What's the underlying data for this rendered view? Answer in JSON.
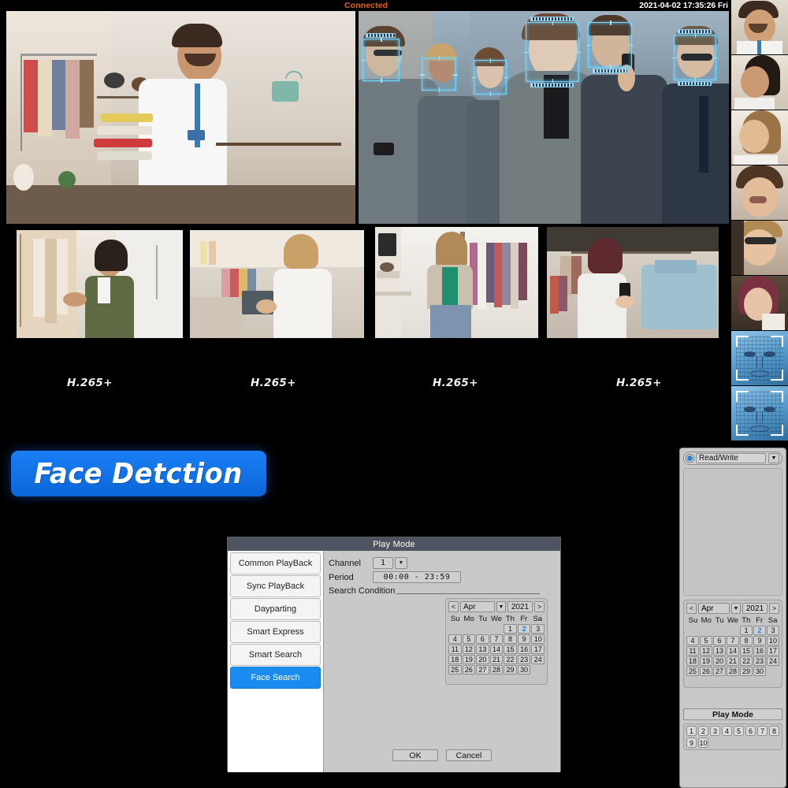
{
  "statusbar": {
    "connected": "Connected",
    "datetime": "2021-04-02 17:35:26 Fri"
  },
  "liveview": {
    "panes": [
      {
        "name": "pane-1",
        "codec": ""
      },
      {
        "name": "pane-2",
        "codec": ""
      },
      {
        "name": "pane-3",
        "codec": "H.265+"
      },
      {
        "name": "pane-4",
        "codec": "H.265+"
      },
      {
        "name": "pane-5",
        "codec": "H.265+"
      },
      {
        "name": "pane-6",
        "codec": "H.265+"
      }
    ],
    "codec_labels": [
      "H.265+",
      "H.265+",
      "H.265+",
      "H.265+"
    ]
  },
  "banner": {
    "text": "Face Detction"
  },
  "dialog": {
    "title": "Play Mode",
    "modes": [
      {
        "label": "Common PlayBack",
        "active": false
      },
      {
        "label": "Sync PlayBack",
        "active": false
      },
      {
        "label": "Dayparting",
        "active": false
      },
      {
        "label": "Smart Express",
        "active": false
      },
      {
        "label": "Smart Search",
        "active": false
      },
      {
        "label": "Face Search",
        "active": true
      }
    ],
    "channel_label": "Channel",
    "channel_value": "1",
    "period_label": "Period",
    "period_value": "00:00  -  23:59",
    "search_condition_label": "Search Condition",
    "calendar": {
      "prev": "<",
      "next": ">",
      "month": "Apr",
      "year": "2021",
      "dow": [
        "Su",
        "Mo",
        "Tu",
        "We",
        "Th",
        "Fr",
        "Sa"
      ],
      "lead_blanks": 4,
      "days": [
        1,
        2,
        3,
        4,
        5,
        6,
        7,
        8,
        9,
        10,
        11,
        12,
        13,
        14,
        15,
        16,
        17,
        18,
        19,
        20,
        21,
        22,
        23,
        24,
        25,
        26,
        27,
        28,
        29,
        30
      ],
      "selected": 2
    },
    "ok_label": "OK",
    "cancel_label": "Cancel"
  },
  "sidepanel": {
    "readwrite_label": "Read/Write",
    "calendar": {
      "prev": "<",
      "next": ">",
      "month": "Apr",
      "year": "2021",
      "dow": [
        "Su",
        "Mo",
        "Tu",
        "We",
        "Th",
        "Fr",
        "Sa"
      ],
      "lead_blanks": 4,
      "days": [
        1,
        2,
        3,
        4,
        5,
        6,
        7,
        8,
        9,
        10,
        11,
        12,
        13,
        14,
        15,
        16,
        17,
        18,
        19,
        20,
        21,
        22,
        23,
        24,
        25,
        26,
        27,
        28,
        29,
        30
      ],
      "selected": 2
    },
    "playmode_label": "Play Mode",
    "channels": [
      1,
      2,
      3,
      4,
      5,
      6,
      7,
      8,
      9,
      10
    ]
  },
  "colors": {
    "accent_blue": "#1a8cf0",
    "banner_blue": "#0a66d8",
    "connected_orange": "#e2661a",
    "face_box_cyan": "#6fd4ff",
    "dialog_gray": "#c9c9c9",
    "titlebar_gray": "#4e5560"
  }
}
